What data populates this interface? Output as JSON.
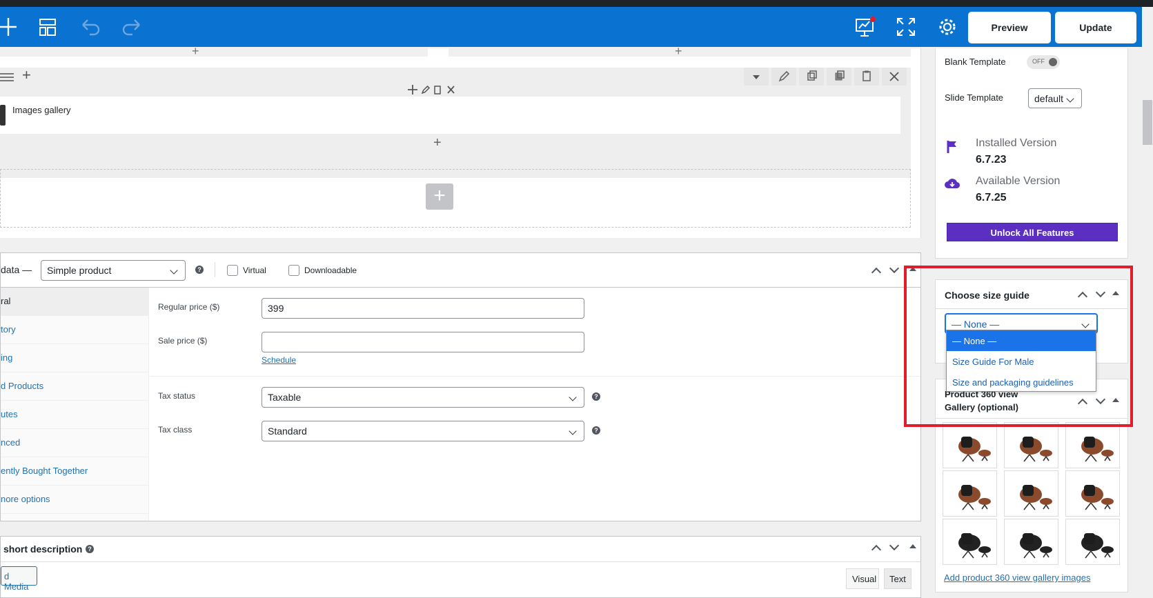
{
  "toolbar": {
    "preview_label": "Preview",
    "update_label": "Update"
  },
  "builder": {
    "element_title": "Images gallery"
  },
  "product_data": {
    "title": "data —",
    "type_value": "Simple product",
    "virtual_label": "Virtual",
    "downloadable_label": "Downloadable",
    "tabs": [
      "ral",
      "tory",
      "ing",
      "d Products",
      "utes",
      "nced",
      "ently Bought Together",
      "nore options"
    ],
    "regular_price_label": "Regular price ($)",
    "regular_price_value": "399",
    "sale_price_label": "Sale price ($)",
    "sale_price_value": "",
    "schedule_link": "Schedule",
    "tax_status_label": "Tax status",
    "tax_status_value": "Taxable",
    "tax_class_label": "Tax class",
    "tax_class_value": "Standard"
  },
  "short_description": {
    "title": "short description",
    "add_media_label": "d Media",
    "tab_visual": "Visual",
    "tab_text": "Text"
  },
  "sidebar": {
    "blank_template_label": "Blank Template",
    "blank_template_state": "OFF",
    "slide_template_label": "Slide Template",
    "slide_template_value": "default",
    "installed_version_label": "Installed Version",
    "installed_version_value": "6.7.23",
    "available_version_label": "Available Version",
    "available_version_value": "6.7.25",
    "unlock_label": "Unlock All Features",
    "size_guide_title": "Choose size guide",
    "size_guide_selected": "— None —",
    "size_guide_options": [
      "— None —",
      "Size Guide For Male",
      "Size and packaging guidelines"
    ],
    "gallery_title_line1": "Product 360 view",
    "gallery_title_line2": "Gallery (optional)",
    "gallery_link": "Add product 360 view gallery images"
  },
  "colors": {
    "toolbar": "#0a72d0",
    "accent_purple": "#5b2fc2",
    "highlight": "#e01e2b",
    "selected_option": "#1a73e8"
  }
}
